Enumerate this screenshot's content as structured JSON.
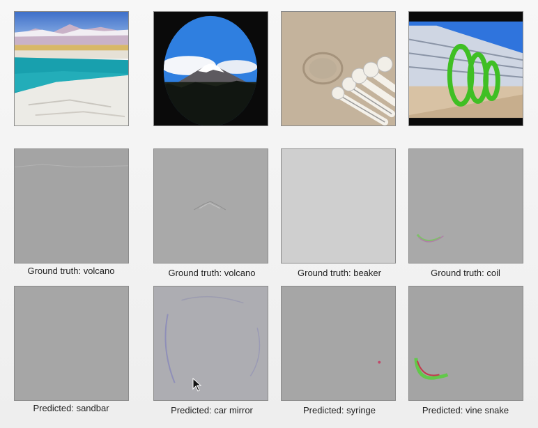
{
  "grid": {
    "ground_truth_captions": [
      "Ground truth: volcano",
      "Ground truth: volcano",
      "Ground truth: beaker",
      "Ground truth: coil"
    ],
    "predicted_captions": [
      "Predicted: sandbar",
      "Predicted: car mirror",
      "Predicted: syringe",
      "Predicted: vine snake"
    ]
  },
  "colors": {
    "saliency_gray": "#a4a4a4",
    "saliency_light": "#cfcfcf",
    "coil_green": "#4bc22d",
    "sky_blue": "#2f7fe0",
    "lagoon_teal": "#1b9aa8"
  },
  "icons": [
    "mouse-pointer-icon"
  ]
}
